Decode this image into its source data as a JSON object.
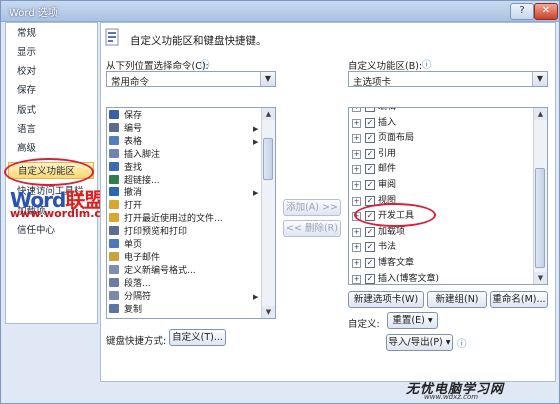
{
  "window": {
    "title": "Word 选项"
  },
  "nav": {
    "items": [
      {
        "label": "常规",
        "selected": false
      },
      {
        "label": "显示",
        "selected": false
      },
      {
        "label": "校对",
        "selected": false
      },
      {
        "label": "保存",
        "selected": false
      },
      {
        "label": "版式",
        "selected": false
      },
      {
        "label": "语言",
        "selected": false
      },
      {
        "label": "高级",
        "selected": false
      },
      {
        "label": "自定义功能区",
        "selected": true
      },
      {
        "label": "快速访问工具栏",
        "selected": false
      },
      {
        "label": "加载项",
        "selected": false
      },
      {
        "label": "信任中心",
        "selected": false
      }
    ]
  },
  "watermark": {
    "brand_a": "Word",
    "brand_b": "联盟",
    "url": "www.wordlm.com"
  },
  "header": {
    "text": "自定义功能区和键盘快捷键。"
  },
  "left": {
    "label": "从下列位置选择命令(C):",
    "combo_value": "常用命令",
    "commands": [
      {
        "label": "保存",
        "color": "#3a5fa8",
        "submenu": false
      },
      {
        "label": "编号",
        "color": "#5a6b8c",
        "submenu": true
      },
      {
        "label": "表格",
        "color": "#4f7fbf",
        "submenu": true
      },
      {
        "label": "插入脚注",
        "color": "#6e86b3",
        "submenu": false
      },
      {
        "label": "查找",
        "color": "#3f6ab0",
        "submenu": false
      },
      {
        "label": "超链接...",
        "color": "#2f7d4c",
        "submenu": false
      },
      {
        "label": "撤消",
        "color": "#2d66b3",
        "submenu": true
      },
      {
        "label": "打开",
        "color": "#d9a62e",
        "submenu": false
      },
      {
        "label": "打开最近使用过的文件...",
        "color": "#d9a62e",
        "submenu": false
      },
      {
        "label": "打印预览和打印",
        "color": "#5b6e92",
        "submenu": false
      },
      {
        "label": "单页",
        "color": "#4b78b8",
        "submenu": false
      },
      {
        "label": "电子邮件",
        "color": "#c9a43b",
        "submenu": false
      },
      {
        "label": "定义新编号格式...",
        "color": "#7d8fb0",
        "submenu": false
      },
      {
        "label": "段落...",
        "color": "#6a7ea4",
        "submenu": false
      },
      {
        "label": "分隔符",
        "color": "#7a8aa8",
        "submenu": true
      },
      {
        "label": "复制",
        "color": "#5a74a6",
        "submenu": false
      }
    ],
    "shortcut_label": "键盘快捷方式:",
    "shortcut_button": "自定义(T)..."
  },
  "middle": {
    "add_button": "添加(A) >>",
    "remove_button": "<< 删除(R)"
  },
  "right": {
    "label": "自定义功能区(B):",
    "combo_value": "主选项卡",
    "tabs": [
      {
        "label": "编辑",
        "checked": true
      },
      {
        "label": "插入",
        "checked": true
      },
      {
        "label": "页面布局",
        "checked": true
      },
      {
        "label": "引用",
        "checked": true
      },
      {
        "label": "邮件",
        "checked": true
      },
      {
        "label": "审阅",
        "checked": true
      },
      {
        "label": "视图",
        "checked": true
      },
      {
        "label": "开发工具",
        "checked": true
      },
      {
        "label": "加载项",
        "checked": true
      },
      {
        "label": "书法",
        "checked": true
      },
      {
        "label": "博客文章",
        "checked": true
      },
      {
        "label": "插入(博客文章)",
        "checked": true
      }
    ],
    "new_tab_button": "新建选项卡(W)",
    "new_group_button": "新建组(N)",
    "rename_button": "重命名(M)...",
    "customize_label": "自定义:",
    "reset_button": "重置(E) ▾",
    "import_export_button": "导入/导出(P) ▾"
  },
  "brand": {
    "text": "无忧电脑学习网",
    "url": "www.wdxz.com"
  }
}
